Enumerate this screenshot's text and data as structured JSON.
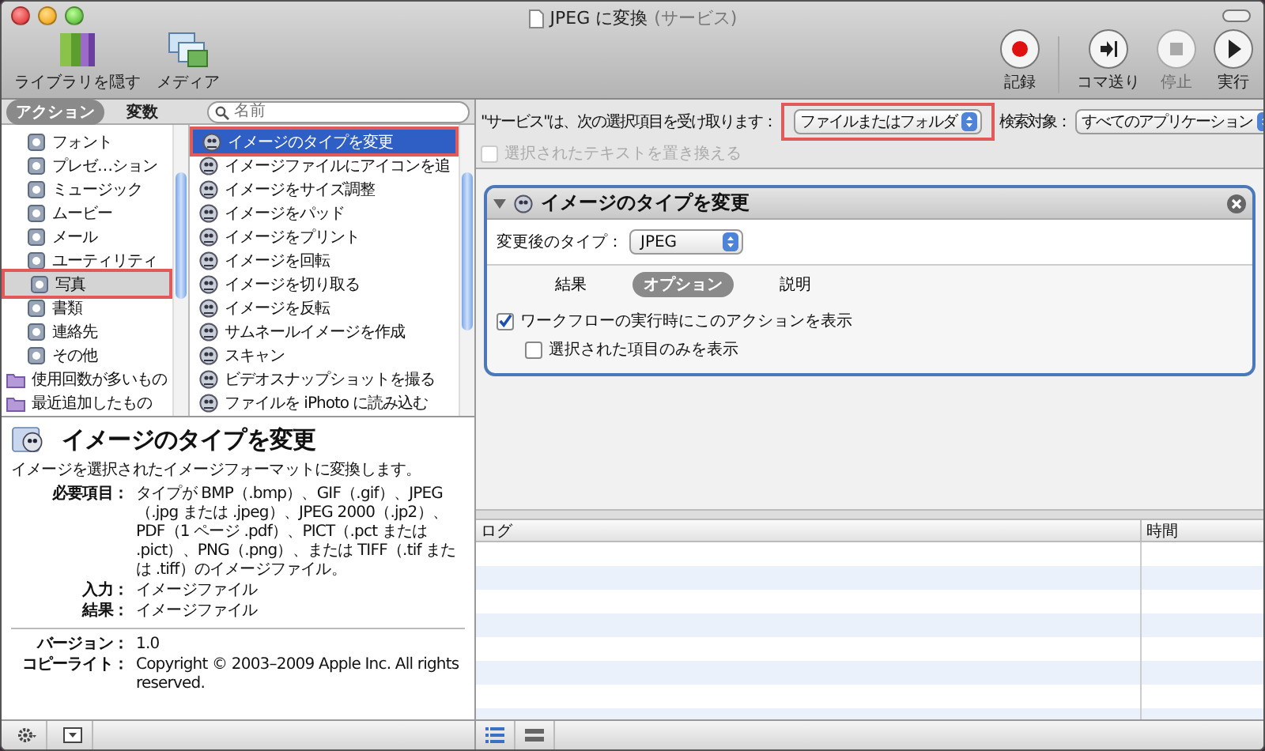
{
  "window": {
    "title": "JPEG に変換",
    "title_suffix": "(サービス)"
  },
  "toolbar": {
    "left": [
      {
        "label": "ライブラリを隠す",
        "kind": "library"
      },
      {
        "label": "メディア",
        "kind": "media"
      }
    ],
    "right": [
      {
        "label": "記録",
        "kind": "record",
        "disabled": false
      },
      {
        "label": "コマ送り",
        "kind": "step",
        "disabled": false
      },
      {
        "label": "停止",
        "kind": "stop",
        "disabled": true
      },
      {
        "label": "実行",
        "kind": "run",
        "disabled": false
      }
    ]
  },
  "library_tabs": [
    {
      "label": "アクション",
      "selected": true
    },
    {
      "label": "変数",
      "selected": false
    }
  ],
  "search": {
    "placeholder": "名前"
  },
  "categories": [
    {
      "label": "フォント",
      "kind": "category",
      "selected": false,
      "highlighted": false
    },
    {
      "label": "プレゼ…ション",
      "kind": "category",
      "selected": false,
      "highlighted": false
    },
    {
      "label": "ミュージック",
      "kind": "category",
      "selected": false,
      "highlighted": false
    },
    {
      "label": "ムービー",
      "kind": "category",
      "selected": false,
      "highlighted": false
    },
    {
      "label": "メール",
      "kind": "category",
      "selected": false,
      "highlighted": false
    },
    {
      "label": "ユーティリティ",
      "kind": "category",
      "selected": false,
      "highlighted": false
    },
    {
      "label": "写真",
      "kind": "category",
      "selected": true,
      "highlighted": true
    },
    {
      "label": "書類",
      "kind": "category",
      "selected": false,
      "highlighted": false
    },
    {
      "label": "連絡先",
      "kind": "category",
      "selected": false,
      "highlighted": false
    },
    {
      "label": "その他",
      "kind": "category",
      "selected": false,
      "highlighted": false
    },
    {
      "label": "使用回数が多いもの",
      "kind": "folder",
      "selected": false,
      "highlighted": false
    },
    {
      "label": "最近追加したもの",
      "kind": "folder",
      "selected": false,
      "highlighted": false
    }
  ],
  "actions": [
    {
      "label": "イメージのタイプを変更",
      "selected": true,
      "highlighted": true
    },
    {
      "label": "イメージファイルにアイコンを追",
      "selected": false,
      "highlighted": false
    },
    {
      "label": "イメージをサイズ調整",
      "selected": false,
      "highlighted": false
    },
    {
      "label": "イメージをパッド",
      "selected": false,
      "highlighted": false
    },
    {
      "label": "イメージをプリント",
      "selected": false,
      "highlighted": false
    },
    {
      "label": "イメージを回転",
      "selected": false,
      "highlighted": false
    },
    {
      "label": "イメージを切り取る",
      "selected": false,
      "highlighted": false
    },
    {
      "label": "イメージを反転",
      "selected": false,
      "highlighted": false
    },
    {
      "label": "サムネールイメージを作成",
      "selected": false,
      "highlighted": false
    },
    {
      "label": "スキャン",
      "selected": false,
      "highlighted": false
    },
    {
      "label": "ビデオスナップショットを撮る",
      "selected": false,
      "highlighted": false
    },
    {
      "label": "ファイルを iPhoto に読み込む",
      "selected": false,
      "highlighted": false
    }
  ],
  "description": {
    "title": "イメージのタイプを変更",
    "summary": "イメージを選択されたイメージフォーマットに変換します。",
    "fields": [
      {
        "label": "必要項目：",
        "value": "タイプが BMP（.bmp）、GIF（.gif）、JPEG（.jpg または .jpeg）、JPEG 2000（.jp2）、PDF（1 ページ .pdf）、PICT（.pct または .pict）、PNG（.png）、または TIFF（.tif または .tiff）のイメージファイル。"
      },
      {
        "label": "入力：",
        "value": "イメージファイル"
      },
      {
        "label": "結果：",
        "value": "イメージファイル"
      }
    ],
    "info_fields": [
      {
        "label": "バージョン：",
        "value": "1.0"
      },
      {
        "label": "コピーライト：",
        "value": "Copyright © 2003–2009 Apple Inc.  All rights reserved."
      }
    ]
  },
  "service_bar": {
    "receives_label": "\"サービス\"は、次の選択項目を受け取ります：",
    "receives_value": "ファイルまたはフォルダ",
    "receives_highlighted": true,
    "target_label": "検索対象：",
    "target_value": "すべてのアプリケーション",
    "replace_text": {
      "label": "選択されたテキストを置き換える",
      "checked": false,
      "disabled": true
    }
  },
  "action_card": {
    "title": "イメージのタイプを変更",
    "expanded": true,
    "type_label": "変更後のタイプ：",
    "type_value": "JPEG",
    "tabs": [
      {
        "label": "結果",
        "selected": false
      },
      {
        "label": "オプション",
        "selected": true
      },
      {
        "label": "説明",
        "selected": false
      }
    ],
    "options": [
      {
        "label": "ワークフローの実行時にこのアクションを表示",
        "checked": true,
        "children": [
          {
            "label": "選択された項目のみを表示",
            "checked": false
          }
        ]
      }
    ]
  },
  "log": {
    "columns": [
      "ログ",
      "時間"
    ]
  }
}
